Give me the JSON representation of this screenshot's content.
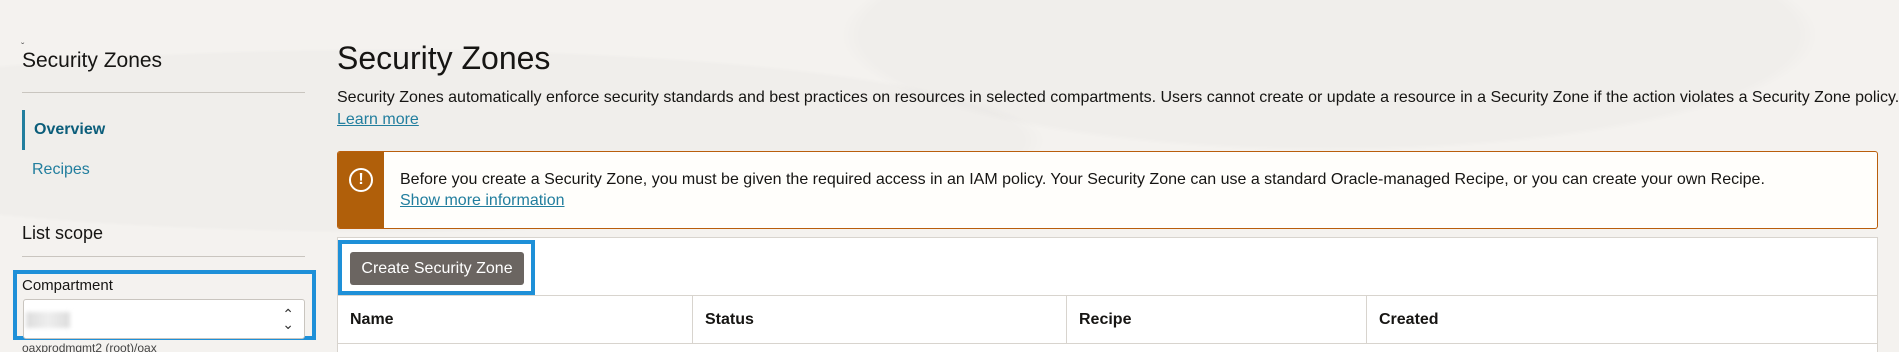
{
  "sidebar": {
    "title": "Security Zones",
    "items": [
      {
        "label": "Overview",
        "active": true
      },
      {
        "label": "Recipes",
        "active": false
      }
    ],
    "list_scope_heading": "List scope",
    "compartment": {
      "label": "Compartment",
      "path": "oaxprodmgmt2 (root)/oax"
    }
  },
  "main": {
    "title": "Security Zones",
    "description": "Security Zones automatically enforce security standards and best practices on resources in selected compartments. Users cannot create or update a resource in a Security Zone if the action violates a Security Zone policy.",
    "learn_more": "Learn more",
    "alert": {
      "icon": "warning-icon",
      "text": "Before you create a Security Zone, you must be given the required access in an IAM policy. Your Security Zone can use a standard Oracle-managed Recipe, or you can create your own Recipe.",
      "link": "Show more information",
      "color": "#b05f0a"
    },
    "create_button": "Create Security Zone",
    "table": {
      "columns": [
        "Name",
        "Status",
        "Recipe",
        "Created"
      ]
    }
  },
  "colors": {
    "highlight": "#1e90d8",
    "link": "#227e9e",
    "button": "#6b6561"
  }
}
